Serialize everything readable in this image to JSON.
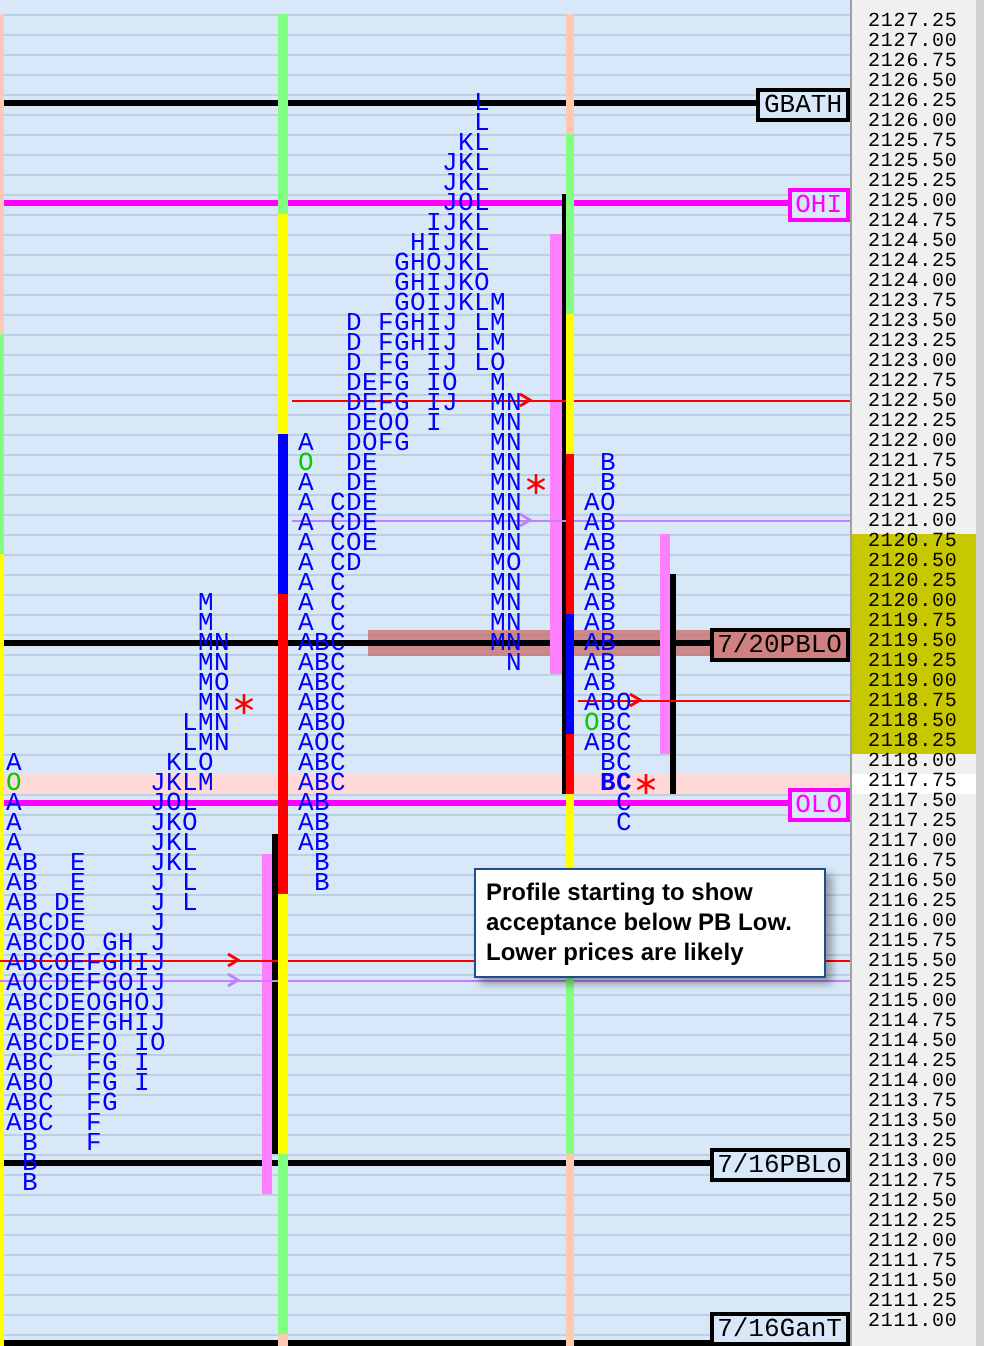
{
  "axis": {
    "labels": [
      {
        "text": "2127.25",
        "value_area": false,
        "current": false
      },
      {
        "text": "2127.00",
        "value_area": false,
        "current": false
      },
      {
        "text": "2126.75",
        "value_area": false,
        "current": false
      },
      {
        "text": "2126.50",
        "value_area": false,
        "current": false
      },
      {
        "text": "2126.25",
        "value_area": false,
        "current": false
      },
      {
        "text": "2126.00",
        "value_area": false,
        "current": false
      },
      {
        "text": "2125.75",
        "value_area": false,
        "current": false
      },
      {
        "text": "2125.50",
        "value_area": false,
        "current": false
      },
      {
        "text": "2125.25",
        "value_area": false,
        "current": false
      },
      {
        "text": "2125.00",
        "value_area": false,
        "current": false
      },
      {
        "text": "2124.75",
        "value_area": false,
        "current": false
      },
      {
        "text": "2124.50",
        "value_area": false,
        "current": false
      },
      {
        "text": "2124.25",
        "value_area": false,
        "current": false
      },
      {
        "text": "2124.00",
        "value_area": false,
        "current": false
      },
      {
        "text": "2123.75",
        "value_area": false,
        "current": false
      },
      {
        "text": "2123.50",
        "value_area": false,
        "current": false
      },
      {
        "text": "2123.25",
        "value_area": false,
        "current": false
      },
      {
        "text": "2123.00",
        "value_area": false,
        "current": false
      },
      {
        "text": "2122.75",
        "value_area": false,
        "current": false
      },
      {
        "text": "2122.50",
        "value_area": false,
        "current": false
      },
      {
        "text": "2122.25",
        "value_area": false,
        "current": false
      },
      {
        "text": "2122.00",
        "value_area": false,
        "current": false
      },
      {
        "text": "2121.75",
        "value_area": false,
        "current": false
      },
      {
        "text": "2121.50",
        "value_area": false,
        "current": false
      },
      {
        "text": "2121.25",
        "value_area": false,
        "current": false
      },
      {
        "text": "2121.00",
        "value_area": false,
        "current": false
      },
      {
        "text": "2120.75",
        "value_area": true,
        "current": false
      },
      {
        "text": "2120.50",
        "value_area": true,
        "current": false
      },
      {
        "text": "2120.25",
        "value_area": true,
        "current": false
      },
      {
        "text": "2120.00",
        "value_area": true,
        "current": false
      },
      {
        "text": "2119.75",
        "value_area": true,
        "current": false
      },
      {
        "text": "2119.50",
        "value_area": true,
        "current": false
      },
      {
        "text": "2119.25",
        "value_area": true,
        "current": false
      },
      {
        "text": "2119.00",
        "value_area": true,
        "current": false
      },
      {
        "text": "2118.75",
        "value_area": true,
        "current": false
      },
      {
        "text": "2118.50",
        "value_area": true,
        "current": false
      },
      {
        "text": "2118.25",
        "value_area": true,
        "current": false
      },
      {
        "text": "2118.00",
        "value_area": false,
        "current": false
      },
      {
        "text": "2117.75",
        "value_area": false,
        "current": true
      },
      {
        "text": "2117.50",
        "value_area": false,
        "current": false
      },
      {
        "text": "2117.25",
        "value_area": false,
        "current": false
      },
      {
        "text": "2117.00",
        "value_area": false,
        "current": false
      },
      {
        "text": "2116.75",
        "value_area": false,
        "current": false
      },
      {
        "text": "2116.50",
        "value_area": false,
        "current": false
      },
      {
        "text": "2116.25",
        "value_area": false,
        "current": false
      },
      {
        "text": "2116.00",
        "value_area": false,
        "current": false
      },
      {
        "text": "2115.75",
        "value_area": false,
        "current": false
      },
      {
        "text": "2115.50",
        "value_area": false,
        "current": false
      },
      {
        "text": "2115.25",
        "value_area": false,
        "current": false
      },
      {
        "text": "2115.00",
        "value_area": false,
        "current": false
      },
      {
        "text": "2114.75",
        "value_area": false,
        "current": false
      },
      {
        "text": "2114.50",
        "value_area": false,
        "current": false
      },
      {
        "text": "2114.25",
        "value_area": false,
        "current": false
      },
      {
        "text": "2114.00",
        "value_area": false,
        "current": false
      },
      {
        "text": "2113.75",
        "value_area": false,
        "current": false
      },
      {
        "text": "2113.50",
        "value_area": false,
        "current": false
      },
      {
        "text": "2113.25",
        "value_area": false,
        "current": false
      },
      {
        "text": "2113.00",
        "value_area": false,
        "current": false
      },
      {
        "text": "2112.75",
        "value_area": false,
        "current": false
      },
      {
        "text": "2112.50",
        "value_area": false,
        "current": false
      },
      {
        "text": "2112.25",
        "value_area": false,
        "current": false
      },
      {
        "text": "2112.00",
        "value_area": false,
        "current": false
      },
      {
        "text": "2111.75",
        "value_area": false,
        "current": false
      },
      {
        "text": "2111.50",
        "value_area": false,
        "current": false
      },
      {
        "text": "2111.25",
        "value_area": false,
        "current": false
      },
      {
        "text": "2111.00",
        "value_area": false,
        "current": false
      }
    ]
  },
  "reference_lines": [
    {
      "label": "GBATH",
      "color": "#000000",
      "kind": "line"
    },
    {
      "label": "OHI",
      "color": "#ff00ff",
      "kind": "line"
    },
    {
      "label": "7/20PBLO",
      "color": "#000000",
      "kind": "zone"
    },
    {
      "label": "OLO",
      "color": "#ff00ff",
      "kind": "line"
    },
    {
      "label": "7/16PBLo",
      "color": "#000000",
      "kind": "line"
    },
    {
      "label": "7/16GanT",
      "color": "#000000",
      "kind": "line"
    }
  ],
  "profiles": [
    {
      "rows": [
        {
          "text": "            M",
          "opening": false,
          "current": false
        },
        {
          "text": "            M",
          "opening": false,
          "current": false
        },
        {
          "text": "            MN",
          "opening": false,
          "current": false
        },
        {
          "text": "            MN",
          "opening": false,
          "current": false
        },
        {
          "text": "            MO",
          "opening": false,
          "current": false
        },
        {
          "text": "            MN",
          "opening": false,
          "current": false
        },
        {
          "text": "           LMN",
          "opening": false,
          "current": false
        },
        {
          "text": "           LMN",
          "opening": false,
          "current": false
        },
        {
          "text": "A         KLO",
          "opening": false,
          "current": false
        },
        {
          "text": "O        JKLM",
          "opening": true,
          "current": false
        },
        {
          "text": "A        JOL",
          "opening": false,
          "current": false
        },
        {
          "text": "A        JKO",
          "opening": false,
          "current": false
        },
        {
          "text": "A        JKL",
          "opening": false,
          "current": false
        },
        {
          "text": "AB  E    JKL",
          "opening": false,
          "current": false
        },
        {
          "text": "AB  E    J L",
          "opening": false,
          "current": false
        },
        {
          "text": "AB DE    J L",
          "opening": false,
          "current": false
        },
        {
          "text": "ABCDE    J",
          "opening": false,
          "current": false
        },
        {
          "text": "ABCDO GH J",
          "opening": false,
          "current": false
        },
        {
          "text": "ABCOEFGHIJ",
          "opening": false,
          "current": false
        },
        {
          "text": "AOCDEFGOIJ",
          "opening": false,
          "current": false
        },
        {
          "text": "ABCDEOGHOJ",
          "opening": false,
          "current": false
        },
        {
          "text": "ABCDEFGHIJ",
          "opening": false,
          "current": false
        },
        {
          "text": "ABCDEFO IO",
          "opening": false,
          "current": false
        },
        {
          "text": "ABC  FG I",
          "opening": false,
          "current": false
        },
        {
          "text": "ABO  FG I",
          "opening": false,
          "current": false
        },
        {
          "text": "ABC  FG",
          "opening": false,
          "current": false
        },
        {
          "text": "ABC  F",
          "opening": false,
          "current": false
        },
        {
          "text": " B   F",
          "opening": false,
          "current": false
        },
        {
          "text": " B",
          "opening": false,
          "current": false
        },
        {
          "text": " B",
          "opening": false,
          "current": false
        }
      ],
      "bar": [
        {
          "color": "#ffc8b8"
        },
        {
          "color": "#80ff80"
        },
        {
          "color": "#ffff00"
        }
      ],
      "markers": [
        {
          "kind": "asterisk",
          "color": "#ff0000"
        },
        {
          "kind": "arrow",
          "color": "#ff0000"
        },
        {
          "kind": "arrow",
          "color": "#c080ff"
        }
      ]
    },
    {
      "rows": [
        {
          "text": "           L",
          "opening": false,
          "current": false
        },
        {
          "text": "           L",
          "opening": false,
          "current": false
        },
        {
          "text": "          KL",
          "opening": false,
          "current": false
        },
        {
          "text": "         JKL",
          "opening": false,
          "current": false
        },
        {
          "text": "         JKL",
          "opening": false,
          "current": false
        },
        {
          "text": "         JOL",
          "opening": false,
          "current": false
        },
        {
          "text": "        IJKL",
          "opening": false,
          "current": false
        },
        {
          "text": "       HIJKL",
          "opening": false,
          "current": false
        },
        {
          "text": "      GHOJKL",
          "opening": false,
          "current": false
        },
        {
          "text": "      GHIJKO",
          "opening": false,
          "current": false
        },
        {
          "text": "      GOIJKLM",
          "opening": false,
          "current": false
        },
        {
          "text": "   D FGHIJ LM",
          "opening": false,
          "current": false
        },
        {
          "text": "   D FGHIJ LM",
          "opening": false,
          "current": false
        },
        {
          "text": "   D FG IJ LO",
          "opening": false,
          "current": false
        },
        {
          "text": "   DEFG IO  M",
          "opening": false,
          "current": false
        },
        {
          "text": "   DEFG IJ  MN",
          "opening": false,
          "current": false
        },
        {
          "text": "   DEOO I   MN",
          "opening": false,
          "current": false
        },
        {
          "text": "A  DOFG     MN",
          "opening": false,
          "current": false
        },
        {
          "text": "O  DE       MN",
          "opening": true,
          "current": false
        },
        {
          "text": "A  DE       MN",
          "opening": false,
          "current": false
        },
        {
          "text": "A CDE       MN",
          "opening": false,
          "current": false
        },
        {
          "text": "A CDE       MN",
          "opening": false,
          "current": false
        },
        {
          "text": "A COE       MN",
          "opening": false,
          "current": false
        },
        {
          "text": "A CD        MO",
          "opening": false,
          "current": false
        },
        {
          "text": "A C         MN",
          "opening": false,
          "current": false
        },
        {
          "text": "A C         MN",
          "opening": false,
          "current": false
        },
        {
          "text": "A C         MN",
          "opening": false,
          "current": false
        },
        {
          "text": "ABC         MN",
          "opening": false,
          "current": false
        },
        {
          "text": "ABC          N",
          "opening": false,
          "current": false
        },
        {
          "text": "ABC",
          "opening": false,
          "current": false
        },
        {
          "text": "ABC",
          "opening": false,
          "current": false
        },
        {
          "text": "ABO",
          "opening": false,
          "current": false
        },
        {
          "text": "AOC",
          "opening": false,
          "current": false
        },
        {
          "text": "ABC",
          "opening": false,
          "current": false
        },
        {
          "text": "ABC",
          "opening": false,
          "current": false
        },
        {
          "text": "AB",
          "opening": false,
          "current": false
        },
        {
          "text": "AB",
          "opening": false,
          "current": false
        },
        {
          "text": "AB",
          "opening": false,
          "current": false
        },
        {
          "text": " B",
          "opening": false,
          "current": false
        },
        {
          "text": " B",
          "opening": false,
          "current": false
        }
      ],
      "bar": [
        {
          "color": "#80ff80"
        },
        {
          "color": "#ffff00"
        },
        {
          "color": "#0000ff"
        },
        {
          "color": "#ff0000"
        },
        {
          "color": "#ffff00"
        },
        {
          "color": "#80ff80"
        },
        {
          "color": "#ffc8b0"
        }
      ],
      "markers": [
        {
          "kind": "arrow",
          "color": "#ff0000"
        },
        {
          "kind": "asterisk",
          "color": "#ff0000"
        },
        {
          "kind": "arrow",
          "color": "#c080ff"
        }
      ]
    },
    {
      "rows": [
        {
          "text": " B",
          "opening": false,
          "current": false
        },
        {
          "text": " B",
          "opening": false,
          "current": false
        },
        {
          "text": "AO",
          "opening": false,
          "current": false
        },
        {
          "text": "AB",
          "opening": false,
          "current": false
        },
        {
          "text": "AB",
          "opening": false,
          "current": false
        },
        {
          "text": "AB",
          "opening": false,
          "current": false
        },
        {
          "text": "AB",
          "opening": false,
          "current": false
        },
        {
          "text": "AB",
          "opening": false,
          "current": false
        },
        {
          "text": "AB",
          "opening": false,
          "current": false
        },
        {
          "text": "AB",
          "opening": false,
          "current": false
        },
        {
          "text": "AB",
          "opening": false,
          "current": false
        },
        {
          "text": "AB",
          "opening": false,
          "current": false
        },
        {
          "text": "ABO",
          "opening": false,
          "current": false
        },
        {
          "text": "OBC",
          "opening": true,
          "current": false
        },
        {
          "text": "ABC",
          "opening": false,
          "current": false
        },
        {
          "text": " BC",
          "opening": false,
          "current": false
        },
        {
          "text": " BC",
          "opening": false,
          "current": true
        },
        {
          "text": "  C",
          "opening": false,
          "current": false
        },
        {
          "text": "  C",
          "opening": false,
          "current": false
        }
      ],
      "bar": [
        {
          "color": "#ffc8b0"
        },
        {
          "color": "#80ff80"
        },
        {
          "color": "#ffff00"
        },
        {
          "color": "#ff0000"
        },
        {
          "color": "#0000ff"
        },
        {
          "color": "#ff0000"
        },
        {
          "color": "#ffff00"
        },
        {
          "color": "#80ff80"
        },
        {
          "color": "#ffc8b0"
        }
      ],
      "markers": [
        {
          "kind": "arrow",
          "color": "#ff0000"
        },
        {
          "kind": "asterisk",
          "color": "#ff0000"
        }
      ]
    }
  ],
  "callout": {
    "lines": [
      "Profile starting to show",
      "acceptance below PB Low.",
      "Lower prices are likely"
    ]
  }
}
